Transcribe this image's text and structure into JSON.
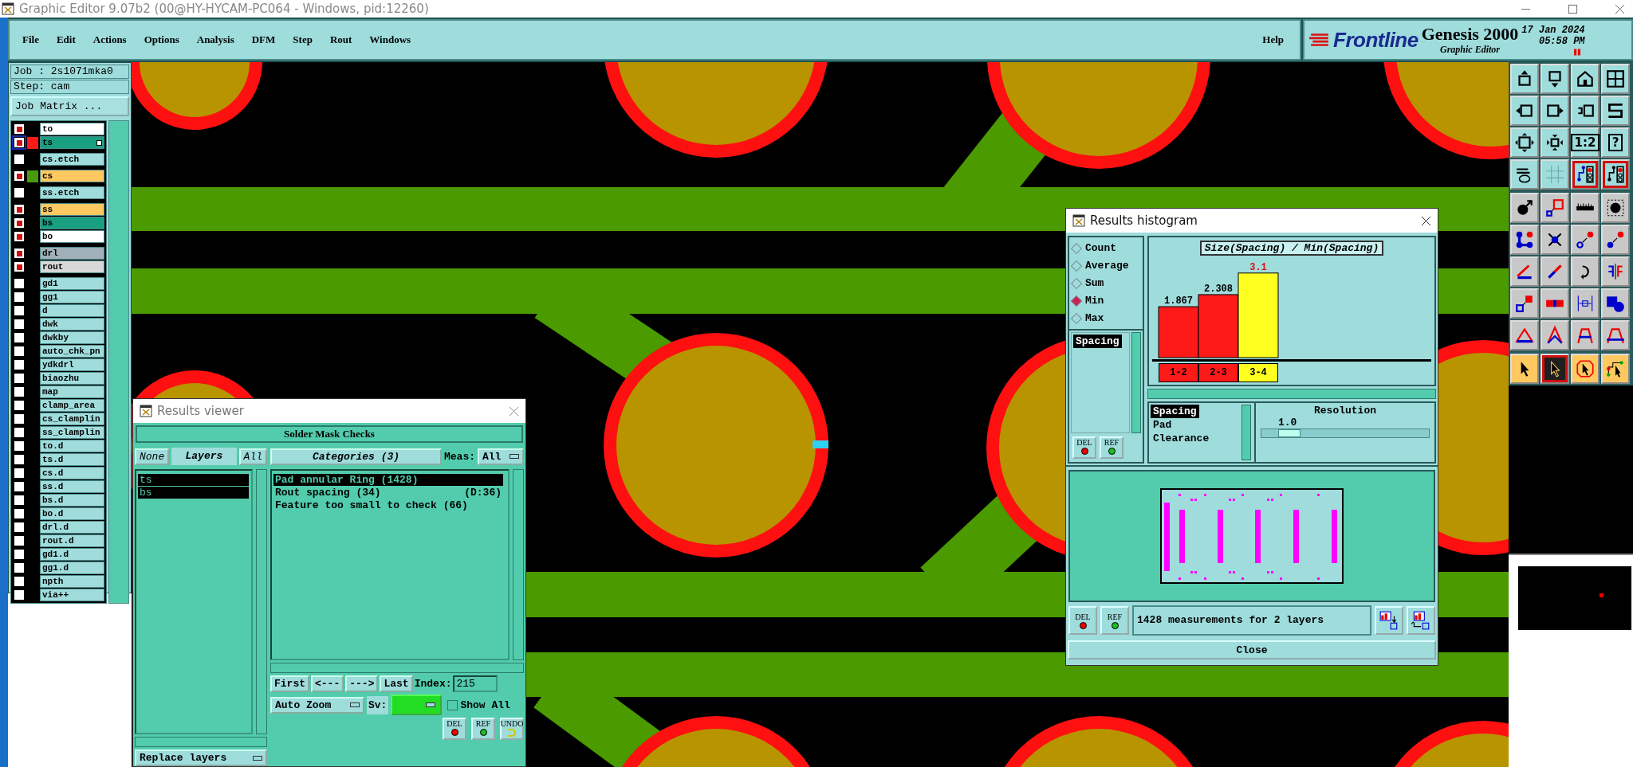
{
  "app_title": "Graphic Editor 9.07b2 (00@HY-HYCAM-PC064 - Windows, pid:12260)",
  "menu": [
    "File",
    "Edit",
    "Actions",
    "Options",
    "Analysis",
    "DFM",
    "Step",
    "Rout",
    "Windows"
  ],
  "help": "Help",
  "brand": {
    "logo": "Frontline",
    "product": "Genesis 2000",
    "subtitle": "Graphic Editor",
    "date": "17 Jan 2024",
    "time": "05:58 PM"
  },
  "job": {
    "job": "Job : 2s1071mka0",
    "step": "Step: cam",
    "matrix_button": "Job Matrix ..."
  },
  "layer_groups": [
    {
      "layers": [
        {
          "name": "to",
          "color": "#ffffff",
          "affected": true,
          "work": false
        },
        {
          "name": "ts",
          "color": "#18a080",
          "affected": true,
          "work": true,
          "swatch": {
            "color": "#ff1a1a"
          }
        }
      ]
    },
    {
      "layers": [
        {
          "name": "cs.etch",
          "color": "#a0dcdc",
          "affected": false,
          "work": false
        }
      ]
    },
    {
      "layers": [
        {
          "name": "cs",
          "color": "#ffc860",
          "affected": true,
          "work": false,
          "swatch": {
            "color": "#4a9a10"
          }
        }
      ]
    },
    {
      "layers": [
        {
          "name": "ss.etch",
          "color": "#a0dcdc",
          "affected": false,
          "work": false
        }
      ]
    },
    {
      "layers": [
        {
          "name": "ss",
          "color": "#ffc860",
          "affected": true,
          "work": false
        },
        {
          "name": "bs",
          "color": "#18a080",
          "affected": true,
          "work": false
        },
        {
          "name": "bo",
          "color": "#ffffff",
          "affected": true,
          "work": false
        }
      ]
    },
    {
      "layers": [
        {
          "name": "drl",
          "color": "#a0b0b8",
          "affected": true,
          "work": false
        },
        {
          "name": "rout",
          "color": "#d8d8d8",
          "affected": true,
          "work": false
        }
      ]
    },
    {
      "layers": [
        {
          "name": "gd1",
          "color": "#a0dcdc",
          "affected": false,
          "work": false
        },
        {
          "name": "gg1",
          "color": "#a0dcdc",
          "affected": false,
          "work": false
        },
        {
          "name": "d",
          "color": "#a0dcdc",
          "affected": false,
          "work": false
        },
        {
          "name": "dwk",
          "color": "#a0dcdc",
          "affected": false,
          "work": false
        },
        {
          "name": "dwkby",
          "color": "#a0dcdc",
          "affected": false,
          "work": false
        },
        {
          "name": "auto_chk_pn",
          "color": "#a0dcdc",
          "affected": false,
          "work": false
        },
        {
          "name": "ydkdrl",
          "color": "#a0dcdc",
          "affected": false,
          "work": false
        },
        {
          "name": "biaozhu",
          "color": "#a0dcdc",
          "affected": false,
          "work": false
        },
        {
          "name": "map",
          "color": "#a0dcdc",
          "affected": false,
          "work": false
        },
        {
          "name": "clamp_area",
          "color": "#a0dcdc",
          "affected": false,
          "work": false
        },
        {
          "name": "cs_clamplin",
          "color": "#a0dcdc",
          "affected": false,
          "work": false
        },
        {
          "name": "ss_clamplin",
          "color": "#a0dcdc",
          "affected": false,
          "work": false
        },
        {
          "name": "to.d",
          "color": "#a0dcdc",
          "affected": false,
          "work": false
        },
        {
          "name": "ts.d",
          "color": "#a0dcdc",
          "affected": false,
          "work": false
        },
        {
          "name": "cs.d",
          "color": "#a0dcdc",
          "affected": false,
          "work": false
        },
        {
          "name": "ss.d",
          "color": "#a0dcdc",
          "affected": false,
          "work": false
        },
        {
          "name": "bs.d",
          "color": "#a0dcdc",
          "affected": false,
          "work": false
        },
        {
          "name": "bo.d",
          "color": "#a0dcdc",
          "affected": false,
          "work": false
        },
        {
          "name": "drl.d",
          "color": "#a0dcdc",
          "affected": false,
          "work": false
        },
        {
          "name": "rout.d",
          "color": "#a0dcdc",
          "affected": false,
          "work": false
        },
        {
          "name": "gd1.d",
          "color": "#a0dcdc",
          "affected": false,
          "work": false
        },
        {
          "name": "gg1.d",
          "color": "#a0dcdc",
          "affected": false,
          "work": false
        },
        {
          "name": "npth",
          "color": "#a0dcdc",
          "affected": false,
          "work": false
        },
        {
          "name": "via++",
          "color": "#a0dcdc",
          "affected": false,
          "work": false
        }
      ]
    }
  ],
  "toolbar_groups": [
    {
      "kind": "view",
      "buttons": [
        {
          "on": false
        },
        {
          "on": false
        },
        {
          "on": false
        },
        {
          "on": false
        },
        {
          "on": false
        },
        {
          "on": false
        },
        {
          "on": false
        },
        {
          "on": false
        },
        {
          "on": false
        },
        {
          "on": false
        },
        {
          "on": false,
          "label": "1:2"
        },
        {
          "on": false,
          "label": "?"
        },
        {
          "on": false
        },
        {
          "on": false
        },
        {
          "on": true
        },
        {
          "on": true
        }
      ]
    },
    {
      "kind": "edit",
      "buttons": [
        {
          "on": false
        },
        {
          "on": false
        },
        {
          "on": false
        },
        {
          "on": false
        },
        {
          "on": false
        },
        {
          "on": false
        },
        {
          "on": false
        },
        {
          "on": false
        },
        {
          "on": false
        },
        {
          "on": false
        },
        {
          "on": false
        },
        {
          "on": false
        },
        {
          "on": false
        },
        {
          "on": false
        },
        {
          "on": false
        },
        {
          "on": false
        },
        {
          "on": false
        },
        {
          "on": false
        },
        {
          "on": false
        },
        {
          "on": false
        }
      ]
    },
    {
      "kind": "select",
      "buttons": [
        {
          "on": false
        },
        {
          "on": true
        },
        {
          "on": false
        },
        {
          "on": false
        }
      ]
    }
  ],
  "results_viewer": {
    "title": "Results viewer",
    "header": "Solder Mask Checks",
    "none_button": "None",
    "layers_title": "Layers",
    "all_button": "All",
    "layers": [
      {
        "name": "ts",
        "selected": true
      },
      {
        "name": "bs",
        "selected": true
      }
    ],
    "categories_title": "Categories (3)",
    "meas_label": "Meas:",
    "meas_value": "All",
    "categories": [
      {
        "label": "Pad annular Ring (1428)",
        "selected": true
      },
      {
        "label": "Rout spacing (34)",
        "extra": "(D:36)",
        "selected": false
      },
      {
        "label": "Feature too small to check (66)",
        "selected": false
      }
    ],
    "nav_buttons": [
      "First",
      "<---",
      "--->",
      "Last"
    ],
    "index_label": "Index:",
    "index_value": "215",
    "zoom_mode": "Auto Zoom",
    "sv_label": "Sv:",
    "sv": {
      "color": "#22dd22"
    },
    "show_all": {
      "label": "Show All",
      "checked": false
    },
    "replace_mode": "Replace layers",
    "actions": [
      {
        "label": "DEL",
        "kind": "del"
      },
      {
        "label": "REF",
        "kind": "ref"
      },
      {
        "label": "UNDO",
        "kind": "undo"
      }
    ]
  },
  "histogram": {
    "title": "Results histogram",
    "modes": [
      {
        "label": "Count",
        "selected": false
      },
      {
        "label": "Average",
        "selected": false
      },
      {
        "label": "Sum",
        "selected": false
      },
      {
        "label": "Min",
        "selected": true
      },
      {
        "label": "Max",
        "selected": false
      }
    ],
    "measures": [
      {
        "label": "Spacing",
        "selected": true
      }
    ],
    "side_actions": [
      {
        "label": "DEL",
        "kind": "del"
      },
      {
        "label": "REF",
        "kind": "ref"
      }
    ],
    "chart_data": {
      "type": "bar",
      "title": "Size(Spacing) / Min(Spacing)",
      "categories": [
        "1-2",
        "2-3",
        "3-4"
      ],
      "values": [
        1.867,
        2.308,
        3.1
      ],
      "data_labels": true
    },
    "bins": [
      {
        "selected": false
      },
      {
        "selected": false
      },
      {
        "selected": true
      }
    ],
    "attributes": [
      {
        "label": "Spacing",
        "selected": true
      },
      {
        "label": "Pad",
        "selected": false
      },
      {
        "label": "Clearance",
        "selected": false
      }
    ],
    "resolution": {
      "label": "Resolution",
      "value": "1.0",
      "level": 0.1
    },
    "actions": [
      {
        "label": "DEL",
        "kind": "del"
      },
      {
        "label": "REF",
        "kind": "ref"
      }
    ],
    "status": "1428 measurements for 2 layers",
    "close": "Close"
  }
}
